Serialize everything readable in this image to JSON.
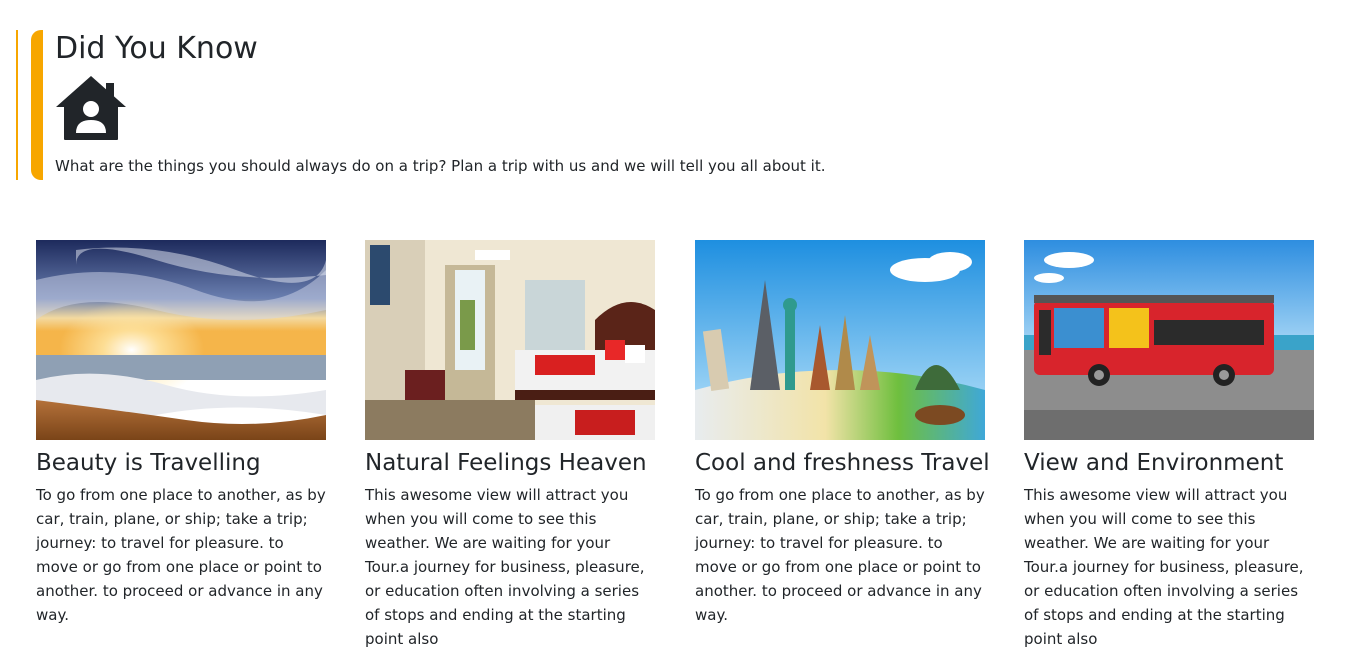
{
  "callout": {
    "title": "Did You Know",
    "icon": "house-user-icon",
    "text": "What are the things you should always do on a trip? Plan a trip with us and we will tell you all about it.",
    "accent_color": "#f7a600"
  },
  "cards": [
    {
      "title": "Beauty is Travelling",
      "image": "beach-sunset-photo",
      "text": "To go from one place to another, as by car, train, plane, or ship; take a trip; journey: to travel for pleasure. to move or go from one place or point to another. to proceed or advance in any way."
    },
    {
      "title": "Natural Feelings Heaven",
      "image": "hotel-room-photo",
      "text": "This awesome view will attract you when you will come to see this weather. We are waiting for your Tour.a journey for business, pleasure, or education often involving a series of stops and ending at the starting point also"
    },
    {
      "title": "Cool and freshness Travel",
      "image": "world-landmarks-photo",
      "text": "To go from one place to another, as by car, train, plane, or ship; take a trip; journey: to travel for pleasure. to move or go from one place or point to another. to proceed or advance in any way."
    },
    {
      "title": "View and Environment",
      "image": "tour-bus-photo",
      "text": "This awesome view will attract you when you will come to see this weather. We are waiting for your Tour.a journey for business, pleasure, or education often involving a series of stops and ending at the starting point also"
    }
  ]
}
